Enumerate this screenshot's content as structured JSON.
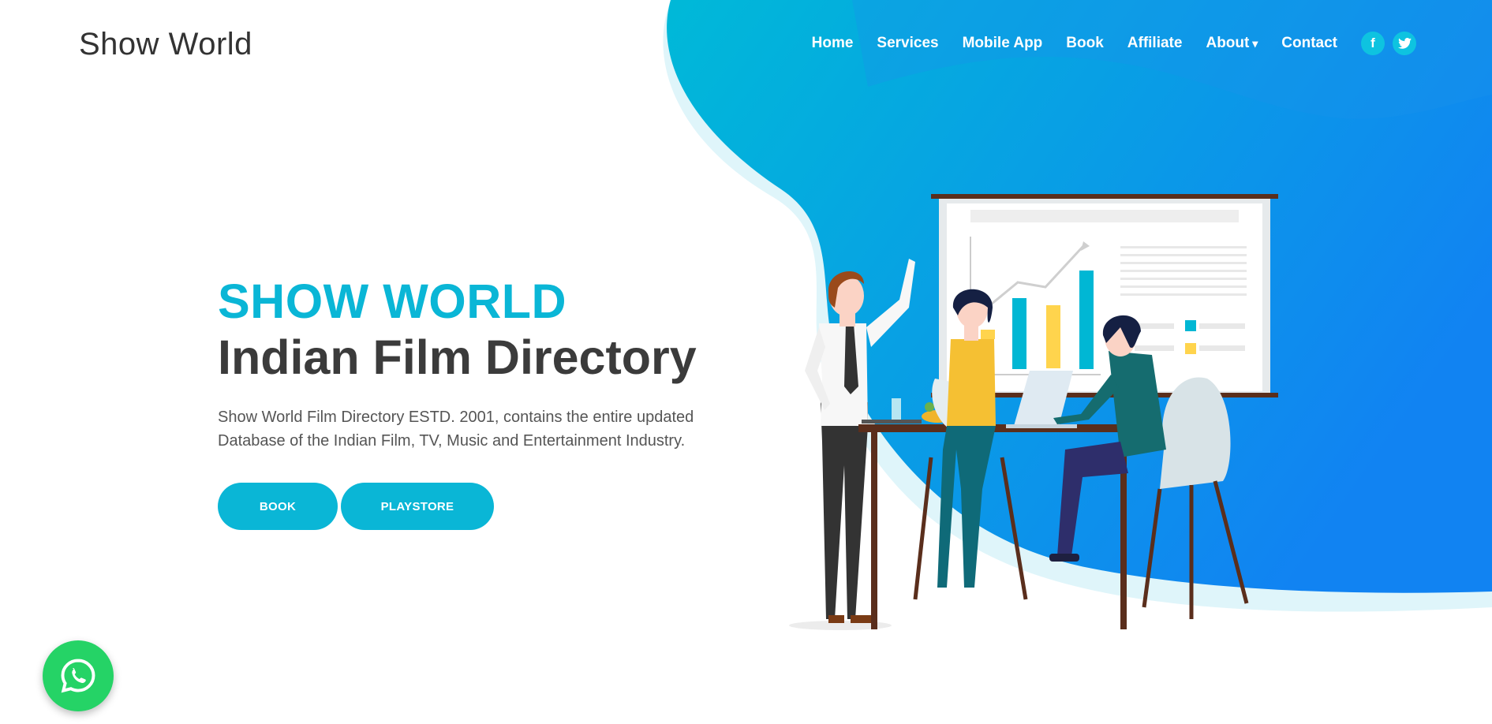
{
  "brand": "Show World",
  "nav": {
    "items": [
      "Home",
      "Services",
      "Mobile App",
      "Book",
      "Affiliate",
      "About",
      "Contact"
    ],
    "social": [
      "facebook-icon",
      "twitter-icon"
    ]
  },
  "hero": {
    "title_line1": "SHOW WORLD",
    "title_line2": "Indian Film Directory",
    "description": "Show World Film Directory ESTD. 2001, contains the entire updated Database of the Indian Film, TV, Music and Entertainment Industry.",
    "buttons": {
      "book": "BOOK",
      "playstore": "PLAYSTORE"
    }
  },
  "colors": {
    "accent": "#0ab6d6",
    "blob_start": "#00b9d8",
    "blob_end": "#1183f2",
    "whatsapp": "#25d366"
  }
}
